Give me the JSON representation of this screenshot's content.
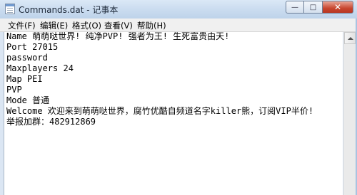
{
  "window": {
    "title": "Commands.dat - 记事本",
    "caption_buttons": {
      "minimize": "—",
      "maximize": "□",
      "close": "✕"
    }
  },
  "menu": {
    "items": [
      {
        "label": "文件(F)"
      },
      {
        "label": "编辑(E)"
      },
      {
        "label": "格式(O)"
      },
      {
        "label": "查看(V)"
      },
      {
        "label": "帮助(H)"
      }
    ]
  },
  "document": {
    "lines": [
      "Name 萌萌哒世界! 纯净PVP! 强者为王! 生死富贵由天!",
      "Port 27015",
      "password",
      "Maxplayers 24",
      "Map PEI",
      "PVP",
      "Mode 普通",
      "Welcome 欢迎来到萌萌哒世界，腐竹优酷自频道名字killer熊，订阅VIP半价!",
      "举报加群：482912869"
    ]
  }
}
